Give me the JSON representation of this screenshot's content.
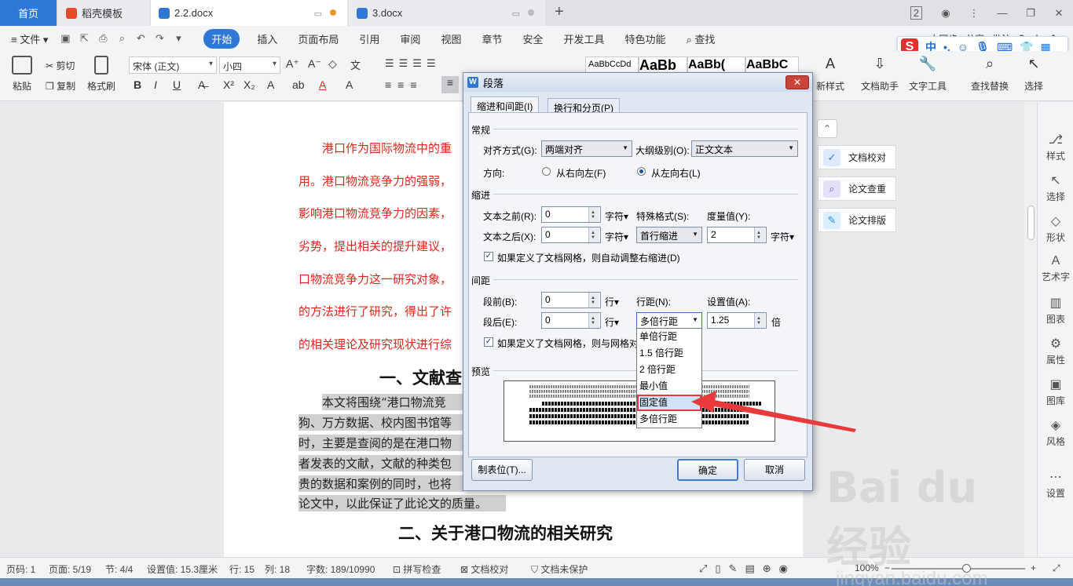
{
  "tabs": [
    {
      "label": "首页"
    },
    {
      "label": "稻壳模板"
    },
    {
      "label": "2.2.docx"
    },
    {
      "label": "3.docx"
    }
  ],
  "window": {
    "badge": "2"
  },
  "menu": {
    "file": "文件",
    "items": [
      "开始",
      "插入",
      "页面布局",
      "引用",
      "审阅",
      "视图",
      "章节",
      "安全",
      "开发工具",
      "特色功能"
    ],
    "search": "查找",
    "sync": "未同步",
    "share": "分享",
    "comment": "批注"
  },
  "ime": {
    "lang": "中"
  },
  "ribbon": {
    "paste": "粘贴",
    "cut": "剪切",
    "copy": "复制",
    "format_painter": "格式刷",
    "font_name": "宋体 (正文)",
    "font_size": "小四",
    "style1": "AaBbCcDd",
    "style2": "AaBb",
    "style3": "AaBb(",
    "style4": "AaBbC",
    "new_style": "新样式",
    "doc_assistant": "文档助手",
    "text_tools": "文字工具",
    "find_replace": "查找替换",
    "select": "选择"
  },
  "document": {
    "red_lines": [
      "港口作为国际物流中的重",
      "用。港口物流竞争力的强弱，",
      "影响港口物流竞争力的因素，",
      "劣势，提出相关的提升建议，",
      "口物流竞争力这一研究对象，",
      "的方法进行了研究，得出了许",
      "的相关理论及研究现状进行综"
    ],
    "heading1": "一、文献查",
    "grey_lines": [
      "本文将围绕“港口物流竞",
      "狗、万方数据、校内图书馆等",
      "时，主要是查阅的是在港口物",
      "者发表的文献，文献的种类包",
      "贵的数据和案例的同时，也将",
      "论文中，以此保证了此论文的质量。"
    ],
    "heading2": "二、关于港口物流的相关研究"
  },
  "helpers": {
    "proofread": "文档校对",
    "check": "论文查重",
    "layout": "论文排版"
  },
  "sidebar": [
    "样式",
    "选择",
    "形状",
    "艺术字",
    "图表",
    "属性",
    "图库",
    "风格",
    "设置"
  ],
  "status": {
    "page_no": "页码: 1",
    "pages": "页面: 5/19",
    "section": "节: 4/4",
    "setting": "设置值: 15.3厘米",
    "row": "行: 15",
    "col": "列: 18",
    "words": "字数: 189/10990",
    "spell": "拼写检查",
    "proof": "文档校对",
    "protect": "文档未保护",
    "zoom": "100%"
  },
  "dialog": {
    "title": "段落",
    "tab_indent": "缩进和间距(I)",
    "tab_break": "换行和分页(P)",
    "general": "常规",
    "align_label": "对齐方式(G):",
    "align_value": "两端对齐",
    "outline_label": "大纲级别(O):",
    "outline_value": "正文文本",
    "direction_label": "方向:",
    "rtl": "从右向左(F)",
    "ltr": "从左向右(L)",
    "indent": "缩进",
    "before_text_label": "文本之前(R):",
    "before_text_value": "0",
    "after_text_label": "文本之后(X):",
    "after_text_value": "0",
    "unit_char": "字符▾",
    "special_label": "特殊格式(S):",
    "special_value": "首行缩进",
    "measure_label": "度量值(Y):",
    "measure_value": "2",
    "auto_indent": "如果定义了文档网格，则自动调整右缩进(D)",
    "spacing": "间距",
    "before_label": "段前(B):",
    "before_value": "0",
    "after_label": "段后(E):",
    "after_value": "0",
    "unit_line": "行▾",
    "line_spacing_label": "行距(N):",
    "line_spacing_value": "多倍行距",
    "set_value_label": "设置值(A):",
    "set_value": "1.25",
    "unit_times": "倍",
    "grid_align": "如果定义了文档网格，则与网格对",
    "preview": "预览",
    "tabs_button": "制表位(T)...",
    "ok": "确定",
    "cancel": "取消",
    "options": [
      "单倍行距",
      "1.5 倍行距",
      "2 倍行距",
      "最小值",
      "固定值",
      "多倍行距"
    ]
  },
  "watermark": {
    "big": "Bai du 经验",
    "small": "jingyan.baidu.com"
  },
  "colors": {
    "accent": "#2f78d6",
    "red_text": "#e0261b",
    "annotation": "#e83a3a"
  }
}
